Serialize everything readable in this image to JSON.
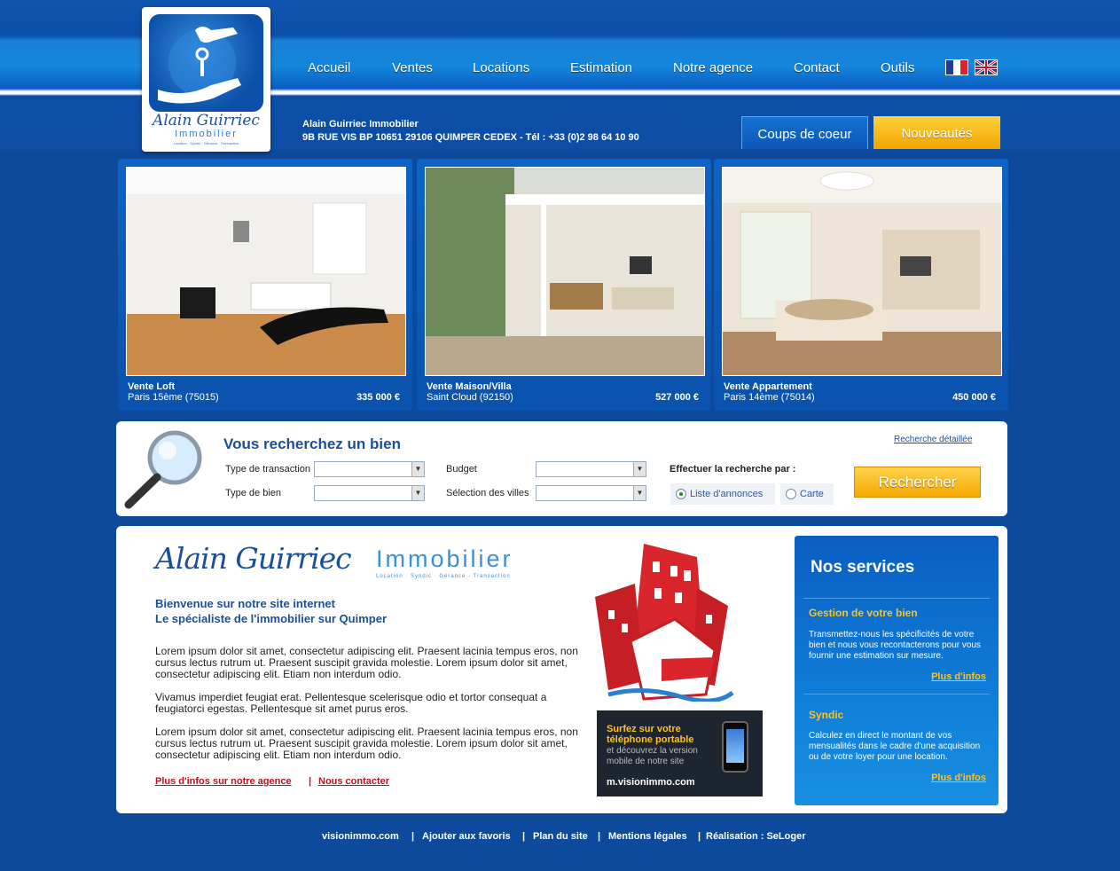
{
  "logo": {
    "name": "Alain Guirriec",
    "sub": "Immobilier",
    "tagline": "Location · Syndic · Gérance · Transaction"
  },
  "nav": [
    "Accueil",
    "Ventes",
    "Locations",
    "Estimation",
    "Notre agence",
    "Contact",
    "Outils"
  ],
  "address": {
    "line1": "Alain Guirriec Immobilier",
    "line2": "9B RUE VIS BP 10651 29106 QUIMPER CEDEX  -  Tél : +33 (0)2 98 64 10 90"
  },
  "tabs": {
    "favorites": "Coups de coeur",
    "new": "Nouveautés"
  },
  "listings": [
    {
      "type": "Vente Loft",
      "city": "Paris 15ème  (75015)",
      "price": "335 000 €"
    },
    {
      "type": "Vente Maison/Villa",
      "city": "Saint Cloud  (92150)",
      "price": "527 000 €"
    },
    {
      "type": "Vente Appartement",
      "city": "Paris 14ème  (75014)",
      "price": "450 000 €"
    }
  ],
  "search": {
    "title": "Vous recherchez un bien",
    "detailed_link": "Recherche détaillée",
    "transaction_label": "Type de transaction",
    "property_label": "Type de bien",
    "budget_label": "Budget",
    "cities_label": "Sélection des villes",
    "by_label": "Effectuer la recherche par :",
    "opt_list": "Liste d'annonces",
    "opt_map": "Carte",
    "button": "Rechercher"
  },
  "main": {
    "brand_name": "Alain Guirriec",
    "brand_sub": "Immobilier",
    "brand_tag": "Location · Syndic · Gérance · Transaction",
    "welcome1": "Bienvenue sur notre site internet",
    "welcome2": "Le spécialiste de l'immobilier sur Quimper",
    "p1": "Lorem ipsum dolor sit amet, consectetur adipiscing elit. Praesent lacinia tempus eros, non cursus lectus rutrum ut. Praesent suscipit gravida molestie. Lorem ipsum dolor sit amet, consectetur adipiscing elit. Etiam non interdum odio.",
    "p2": "Vivamus imperdiet feugiat erat. Pellentesque scelerisque odio et tortor consequat a feugiatorci egestas. Pellentesque sit amet purus eros.",
    "p3": "Lorem ipsum dolor sit amet, consectetur adipiscing elit. Praesent lacinia tempus eros, non cursus lectus rutrum ut. Praesent suscipit gravida molestie. Lorem ipsum dolor sit amet, consectetur adipiscing elit. Etiam non interdum odio.",
    "link_agency": "Plus d'infos sur notre agence",
    "separator": "|",
    "link_contact": "Nous contacter"
  },
  "mobile": {
    "title1": "Surfez sur votre",
    "title2": "téléphone portable",
    "text1": "et découvrez la version",
    "text2": "mobile de notre site",
    "url": "m.visionimmo.com"
  },
  "services": {
    "title": "Nos services",
    "s1_title": "Gestion de votre bien",
    "s1_text": "Transmettez-nous les spécificités de votre bien et nous vous recontacterons pour vous fournir une estimation sur mesure.",
    "s1_more": "Plus d'infos",
    "s2_title": "Syndic",
    "s2_text": "Calculez en direct le montant de vos mensualités dans le cadre d'une acquisition ou de votre loyer pour une location.",
    "s2_more": "Plus d'infos"
  },
  "footer": [
    "visionimmo.com",
    "|",
    "Ajouter aux favoris",
    "|",
    "Plan du site",
    "|",
    "Mentions légales",
    "|",
    "Réalisation : SeLoger"
  ]
}
